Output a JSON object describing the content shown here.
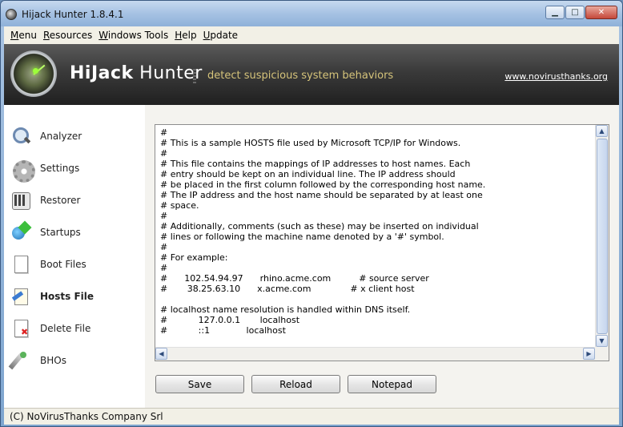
{
  "window": {
    "title": "Hijack Hunter 1.8.4.1"
  },
  "menu": [
    "Menu",
    "Resources",
    "Windows Tools",
    "Help",
    "Update"
  ],
  "banner": {
    "brand_strong": "HiJack",
    "brand_rest": " Hunter",
    "tagline": "detect suspicious system behaviors",
    "site": "www.novirusthanks.org"
  },
  "sidebar": {
    "items": [
      {
        "label": "Analyzer",
        "icon": "magnifier-icon"
      },
      {
        "label": "Settings",
        "icon": "gear-icon"
      },
      {
        "label": "Restorer",
        "icon": "restore-icon"
      },
      {
        "label": "Startups",
        "icon": "startup-icon"
      },
      {
        "label": "Boot Files",
        "icon": "document-icon"
      },
      {
        "label": "Hosts File",
        "icon": "hosts-file-icon",
        "active": true
      },
      {
        "label": "Delete File",
        "icon": "delete-file-icon"
      },
      {
        "label": "BHOs",
        "icon": "bho-icon"
      }
    ]
  },
  "editor": {
    "lines": [
      "#",
      "# This is a sample HOSTS file used by Microsoft TCP/IP for Windows.",
      "#",
      "# This file contains the mappings of IP addresses to host names. Each",
      "# entry should be kept on an individual line. The IP address should",
      "# be placed in the first column followed by the corresponding host name.",
      "# The IP address and the host name should be separated by at least one",
      "# space.",
      "#",
      "# Additionally, comments (such as these) may be inserted on individual",
      "# lines or following the machine name denoted by a '#' symbol.",
      "#",
      "# For example:",
      "#",
      "#      102.54.94.97      rhino.acme.com          # source server",
      "#       38.25.63.10      x.acme.com              # x client host",
      "",
      "# localhost name resolution is handled within DNS itself.",
      "#           127.0.0.1       localhost",
      "#           ::1             localhost"
    ]
  },
  "buttons": {
    "save": "Save",
    "reload": "Reload",
    "notepad": "Notepad"
  },
  "status": {
    "text": "(C) NoVirusThanks Company Srl"
  }
}
